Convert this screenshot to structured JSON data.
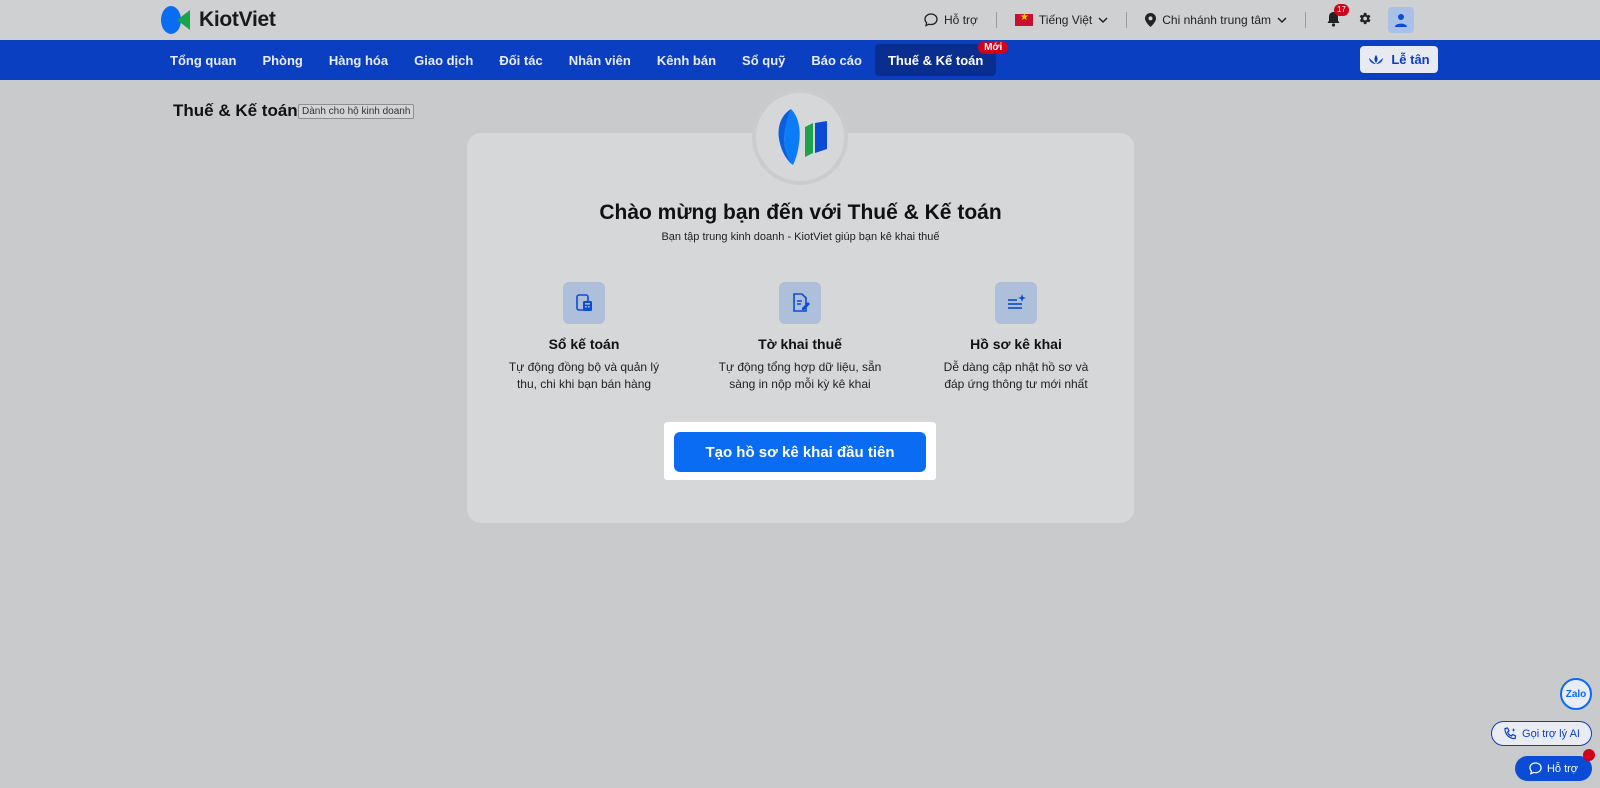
{
  "brand": {
    "name": "KiotViet"
  },
  "topbar": {
    "support": "Hỗ trợ",
    "language": "Tiếng Việt",
    "branch": "Chi nhánh trung tâm",
    "notification_count": "17"
  },
  "nav": {
    "items": [
      "Tổng quan",
      "Phòng",
      "Hàng hóa",
      "Giao dịch",
      "Đối tác",
      "Nhân viên",
      "Kênh bán",
      "Sổ quỹ",
      "Báo cáo",
      "Thuế & Kế toán"
    ],
    "active_index": 9,
    "new_badge": "Mới",
    "reception": "Lễ tân"
  },
  "page": {
    "title": "Thuế & Kế toán",
    "tag": "Dành cho hộ kinh doanh"
  },
  "card": {
    "welcome": "Chào mừng bạn đến với Thuế & Kế toán",
    "subtitle": "Bạn tập trung kinh doanh - KiotViet giúp bạn kê khai thuế",
    "features": [
      {
        "icon": "calculator-icon",
        "title": "Sổ kế toán",
        "desc1": "Tự động đồng bộ và quản lý",
        "desc2": "thu, chi khi bạn bán hàng"
      },
      {
        "icon": "document-edit-icon",
        "title": "Tờ khai thuế",
        "desc1": "Tự động tổng hợp dữ liệu, sẵn",
        "desc2": "sàng in nộp mỗi kỳ kê khai"
      },
      {
        "icon": "list-sparkle-icon",
        "title": "Hồ sơ kê khai",
        "desc1": "Dễ dàng cập nhật hồ sơ và",
        "desc2": "đáp ứng thông tư mới nhất"
      }
    ],
    "cta": "Tạo hồ sơ kê khai đầu tiên"
  },
  "floating": {
    "zalo": "Zalo",
    "ai": "Gọi trợ lý AI",
    "help": "Hỗ trợ"
  },
  "colors": {
    "nav_bg": "#0b3fc2",
    "cta": "#0a6cf2",
    "badge": "#d0021b"
  }
}
